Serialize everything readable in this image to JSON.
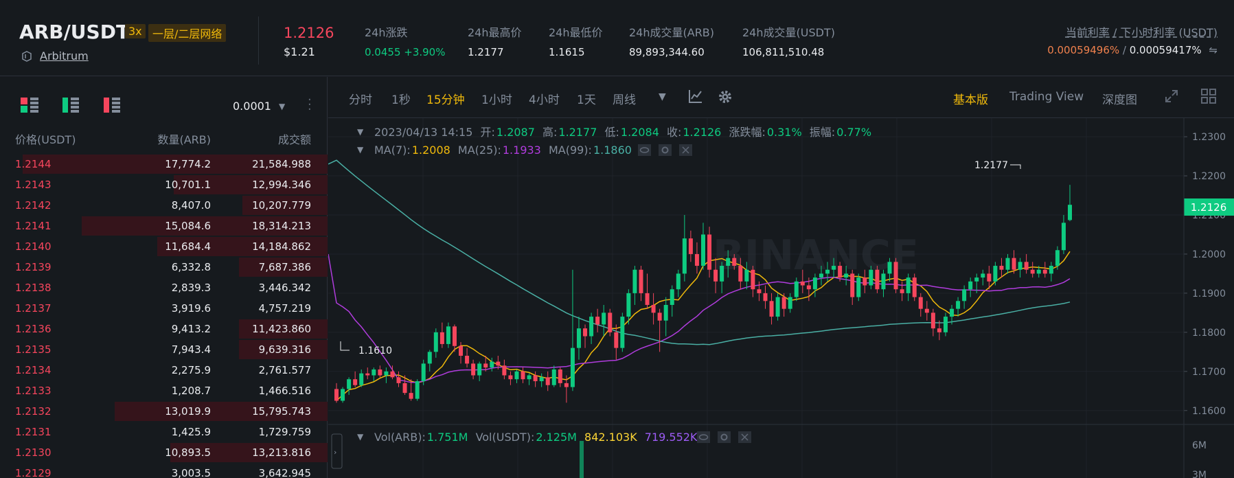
{
  "header": {
    "pair": "ARB/USDT",
    "leverage": "3x",
    "tag": "一层/二层网络",
    "chain_icon": "token-icon",
    "chain": "Arbitrum",
    "last_price": "1.2126",
    "last_price_usd": "$1.21",
    "stats": [
      {
        "label": "24h涨跌",
        "value": "0.0455 +3.90%",
        "up": true
      },
      {
        "label": "24h最高价",
        "value": "1.2177"
      },
      {
        "label": "24h最低价",
        "value": "1.1615"
      },
      {
        "label": "24h成交量(ARB)",
        "value": "89,893,344.60"
      },
      {
        "label": "24h成交量(USDT)",
        "value": "106,811,510.48"
      }
    ],
    "funding_label": "当前利率 / 下小时利率 (USDT)",
    "funding_current": "0.00059496%",
    "funding_sep": " / ",
    "funding_next": "0.00059417%",
    "swap_icon": "swap-icon"
  },
  "orderbook": {
    "precision": "0.0001",
    "columns": [
      "价格(USDT)",
      "数量(ARB)",
      "成交额"
    ],
    "colors": {
      "ask": "#f6465d",
      "ask_bg": "#35141b"
    },
    "rows": [
      {
        "price": "1.2144",
        "qty": "17,774.2",
        "total": "21,584.988",
        "depth": 0.93
      },
      {
        "price": "1.2143",
        "qty": "10,701.1",
        "total": "12,994.346",
        "depth": 0.47
      },
      {
        "price": "1.2142",
        "qty": "8,407.0",
        "total": "10,207.779",
        "depth": 0.26
      },
      {
        "price": "1.2141",
        "qty": "15,084.6",
        "total": "18,314.213",
        "depth": 0.75
      },
      {
        "price": "1.2140",
        "qty": "11,684.4",
        "total": "14,184.862",
        "depth": 0.52
      },
      {
        "price": "1.2139",
        "qty": "6,332.8",
        "total": "7,687.386",
        "depth": 0.27
      },
      {
        "price": "1.2138",
        "qty": "2,839.3",
        "total": "3,446.342",
        "depth": 0.0
      },
      {
        "price": "1.2137",
        "qty": "3,919.6",
        "total": "4,757.219",
        "depth": 0.0
      },
      {
        "price": "1.2136",
        "qty": "9,413.2",
        "total": "11,423.860",
        "depth": 0.27
      },
      {
        "price": "1.2135",
        "qty": "7,943.4",
        "total": "9,639.316",
        "depth": 0.27
      },
      {
        "price": "1.2134",
        "qty": "2,275.9",
        "total": "2,761.577",
        "depth": 0.0
      },
      {
        "price": "1.2133",
        "qty": "1,208.7",
        "total": "1,466.516",
        "depth": 0.0
      },
      {
        "price": "1.2132",
        "qty": "13,019.9",
        "total": "15,795.743",
        "depth": 0.65
      },
      {
        "price": "1.2131",
        "qty": "1,425.9",
        "total": "1,729.759",
        "depth": 0.0
      },
      {
        "price": "1.2130",
        "qty": "10,893.5",
        "total": "13,213.816",
        "depth": 0.48
      },
      {
        "price": "1.2129",
        "qty": "3,003.5",
        "total": "3,642.945",
        "depth": 0.0
      }
    ]
  },
  "toolbar": {
    "intervals": [
      "分时",
      "1秒",
      "15分钟",
      "1小时",
      "4小时",
      "1天",
      "周线"
    ],
    "active_interval": "15分钟",
    "views": [
      "基本版",
      "Trading View",
      "深度图"
    ],
    "active_view": "基本版"
  },
  "chart_info": {
    "date": "2023/04/13 14:15",
    "open_label": "开:",
    "open": "1.2087",
    "high_label": "高:",
    "high": "1.2177",
    "low_label": "低:",
    "low": "1.2084",
    "close_label": "收:",
    "close": "1.2126",
    "change_label": "涨跌幅:",
    "change": "0.31%",
    "amp_label": "振幅:",
    "amp": "0.77%",
    "ma7_label": "MA(7):",
    "ma7": "1.2008",
    "ma25_label": "MA(25):",
    "ma25": "1.1933",
    "ma99_label": "MA(99):",
    "ma99": "1.1860",
    "vol_arb_label": "Vol(ARB):",
    "vol_arb": "1.751M",
    "vol_usdt_label": "Vol(USDT):",
    "vol_usdt": "2.125M",
    "vol_ma1": "842.103K",
    "vol_ma2": "719.552K",
    "max_label": "1.2177",
    "min_label": "1.1610",
    "current_price_tag": "1.2126",
    "watermark": "BINANCE",
    "colors": {
      "up": "#0ecb81",
      "down": "#f6465d",
      "ma7": "#f0b90b",
      "ma25": "#b03cdd",
      "ma99": "#4ab0a5",
      "vol_ma1": "#fcd535",
      "vol_ma2": "#9d5cf6"
    }
  },
  "chart_data": {
    "type": "candlestick",
    "y_ticks": [
      "1.2300",
      "1.2200",
      "1.2100",
      "1.2000",
      "1.1900",
      "1.1800",
      "1.1700",
      "1.1600"
    ],
    "ylim": [
      1.1575,
      1.233
    ],
    "vol_ticks": [
      "6M",
      "3M"
    ],
    "candles_ohlc": [
      [
        1.1655,
        1.167,
        1.162,
        1.1625
      ],
      [
        1.1625,
        1.166,
        1.162,
        1.1655
      ],
      [
        1.1655,
        1.1685,
        1.164,
        1.168
      ],
      [
        1.168,
        1.17,
        1.166,
        1.1665
      ],
      [
        1.1665,
        1.1705,
        1.166,
        1.1695
      ],
      [
        1.1695,
        1.171,
        1.168,
        1.169
      ],
      [
        1.169,
        1.171,
        1.1675,
        1.1705
      ],
      [
        1.1705,
        1.1715,
        1.1685,
        1.169
      ],
      [
        1.169,
        1.171,
        1.167,
        1.17
      ],
      [
        1.17,
        1.1715,
        1.168,
        1.1685
      ],
      [
        1.1685,
        1.17,
        1.166,
        1.167
      ],
      [
        1.167,
        1.169,
        1.164,
        1.1645
      ],
      [
        1.1645,
        1.168,
        1.1625,
        1.163
      ],
      [
        1.163,
        1.168,
        1.1625,
        1.1675
      ],
      [
        1.1675,
        1.173,
        1.1665,
        1.172
      ],
      [
        1.172,
        1.1755,
        1.17,
        1.175
      ],
      [
        1.175,
        1.181,
        1.1735,
        1.18
      ],
      [
        1.18,
        1.1825,
        1.176,
        1.177
      ],
      [
        1.177,
        1.1825,
        1.176,
        1.1815
      ],
      [
        1.1815,
        1.182,
        1.175,
        1.1765
      ],
      [
        1.1765,
        1.1775,
        1.172,
        1.174
      ],
      [
        1.174,
        1.176,
        1.171,
        1.172
      ],
      [
        1.172,
        1.173,
        1.168,
        1.169
      ],
      [
        1.169,
        1.1725,
        1.1675,
        1.172
      ],
      [
        1.172,
        1.174,
        1.17,
        1.171
      ],
      [
        1.171,
        1.1735,
        1.17,
        1.1725
      ],
      [
        1.1725,
        1.174,
        1.1705,
        1.1715
      ],
      [
        1.1715,
        1.173,
        1.168,
        1.169
      ],
      [
        1.169,
        1.17,
        1.1665,
        1.168
      ],
      [
        1.168,
        1.1705,
        1.167,
        1.17
      ],
      [
        1.17,
        1.171,
        1.167,
        1.168
      ],
      [
        1.168,
        1.1695,
        1.1665,
        1.169
      ],
      [
        1.169,
        1.17,
        1.166,
        1.1675
      ],
      [
        1.1675,
        1.1695,
        1.166,
        1.1685
      ],
      [
        1.1685,
        1.17,
        1.165,
        1.1665
      ],
      [
        1.1665,
        1.1715,
        1.166,
        1.1705
      ],
      [
        1.1705,
        1.171,
        1.166,
        1.167
      ],
      [
        1.167,
        1.169,
        1.162,
        1.166
      ],
      [
        1.166,
        1.196,
        1.165,
        1.176
      ],
      [
        1.176,
        1.184,
        1.173,
        1.181
      ],
      [
        1.181,
        1.182,
        1.176,
        1.179
      ],
      [
        1.179,
        1.185,
        1.177,
        1.184
      ],
      [
        1.184,
        1.186,
        1.18,
        1.182
      ],
      [
        1.182,
        1.187,
        1.179,
        1.185
      ],
      [
        1.185,
        1.186,
        1.179,
        1.18
      ],
      [
        1.18,
        1.182,
        1.173,
        1.176
      ],
      [
        1.176,
        1.185,
        1.175,
        1.184
      ],
      [
        1.184,
        1.191,
        1.182,
        1.19
      ],
      [
        1.19,
        1.197,
        1.187,
        1.196
      ],
      [
        1.196,
        1.197,
        1.188,
        1.19
      ],
      [
        1.19,
        1.195,
        1.186,
        1.187
      ],
      [
        1.187,
        1.19,
        1.182,
        1.185
      ],
      [
        1.185,
        1.186,
        1.175,
        1.183
      ],
      [
        1.183,
        1.189,
        1.179,
        1.187
      ],
      [
        1.187,
        1.192,
        1.184,
        1.191
      ],
      [
        1.191,
        1.196,
        1.189,
        1.195
      ],
      [
        1.195,
        1.21,
        1.193,
        1.204
      ],
      [
        1.204,
        1.206,
        1.198,
        1.2
      ],
      [
        1.2,
        1.203,
        1.195,
        1.197
      ],
      [
        1.197,
        1.208,
        1.196,
        1.205
      ],
      [
        1.205,
        1.207,
        1.194,
        1.196
      ],
      [
        1.196,
        1.199,
        1.19,
        1.193
      ],
      [
        1.193,
        1.198,
        1.19,
        1.197
      ],
      [
        1.197,
        1.201,
        1.194,
        1.199
      ],
      [
        1.199,
        1.2,
        1.196,
        1.197
      ],
      [
        1.197,
        1.199,
        1.191,
        1.193
      ],
      [
        1.193,
        1.198,
        1.191,
        1.196
      ],
      [
        1.196,
        1.197,
        1.189,
        1.191
      ],
      [
        1.191,
        1.193,
        1.188,
        1.19
      ],
      [
        1.19,
        1.192,
        1.186,
        1.188
      ],
      [
        1.188,
        1.19,
        1.182,
        1.184
      ],
      [
        1.184,
        1.19,
        1.183,
        1.189
      ],
      [
        1.189,
        1.19,
        1.184,
        1.186
      ],
      [
        1.186,
        1.19,
        1.185,
        1.189
      ],
      [
        1.189,
        1.194,
        1.188,
        1.193
      ],
      [
        1.193,
        1.196,
        1.19,
        1.192
      ],
      [
        1.192,
        1.194,
        1.188,
        1.191
      ],
      [
        1.191,
        1.195,
        1.189,
        1.194
      ],
      [
        1.194,
        1.197,
        1.192,
        1.195
      ],
      [
        1.195,
        1.198,
        1.193,
        1.196
      ],
      [
        1.196,
        1.199,
        1.194,
        1.197
      ],
      [
        1.197,
        1.198,
        1.193,
        1.194
      ],
      [
        1.194,
        1.197,
        1.192,
        1.195
      ],
      [
        1.195,
        1.196,
        1.187,
        1.189
      ],
      [
        1.189,
        1.195,
        1.188,
        1.194
      ],
      [
        1.194,
        1.196,
        1.19,
        1.192
      ],
      [
        1.192,
        1.197,
        1.191,
        1.196
      ],
      [
        1.196,
        1.197,
        1.19,
        1.191
      ],
      [
        1.191,
        1.196,
        1.189,
        1.195
      ],
      [
        1.195,
        1.199,
        1.193,
        1.198
      ],
      [
        1.198,
        1.199,
        1.19,
        1.191
      ],
      [
        1.191,
        1.193,
        1.188,
        1.19
      ],
      [
        1.19,
        1.195,
        1.188,
        1.194
      ],
      [
        1.194,
        1.195,
        1.188,
        1.189
      ],
      [
        1.189,
        1.19,
        1.184,
        1.186
      ],
      [
        1.186,
        1.188,
        1.183,
        1.185
      ],
      [
        1.185,
        1.186,
        1.179,
        1.181
      ],
      [
        1.181,
        1.183,
        1.178,
        1.18
      ],
      [
        1.18,
        1.185,
        1.179,
        1.184
      ],
      [
        1.184,
        1.187,
        1.182,
        1.186
      ],
      [
        1.186,
        1.189,
        1.184,
        1.188
      ],
      [
        1.188,
        1.192,
        1.186,
        1.191
      ],
      [
        1.191,
        1.194,
        1.189,
        1.193
      ],
      [
        1.193,
        1.195,
        1.19,
        1.194
      ],
      [
        1.194,
        1.196,
        1.192,
        1.195
      ],
      [
        1.195,
        1.197,
        1.191,
        1.193
      ],
      [
        1.193,
        1.198,
        1.192,
        1.197
      ],
      [
        1.197,
        1.199,
        1.194,
        1.196
      ],
      [
        1.196,
        1.2,
        1.195,
        1.199
      ],
      [
        1.199,
        1.201,
        1.195,
        1.196
      ],
      [
        1.196,
        1.199,
        1.194,
        1.198
      ],
      [
        1.198,
        1.2,
        1.195,
        1.196
      ],
      [
        1.196,
        1.198,
        1.194,
        1.195
      ],
      [
        1.195,
        1.197,
        1.194,
        1.196
      ],
      [
        1.196,
        1.198,
        1.194,
        1.195
      ],
      [
        1.195,
        1.198,
        1.193,
        1.197
      ],
      [
        1.197,
        1.202,
        1.196,
        1.201
      ],
      [
        1.201,
        1.21,
        1.2,
        1.208
      ],
      [
        1.2087,
        1.2177,
        1.2084,
        1.2126
      ]
    ]
  }
}
